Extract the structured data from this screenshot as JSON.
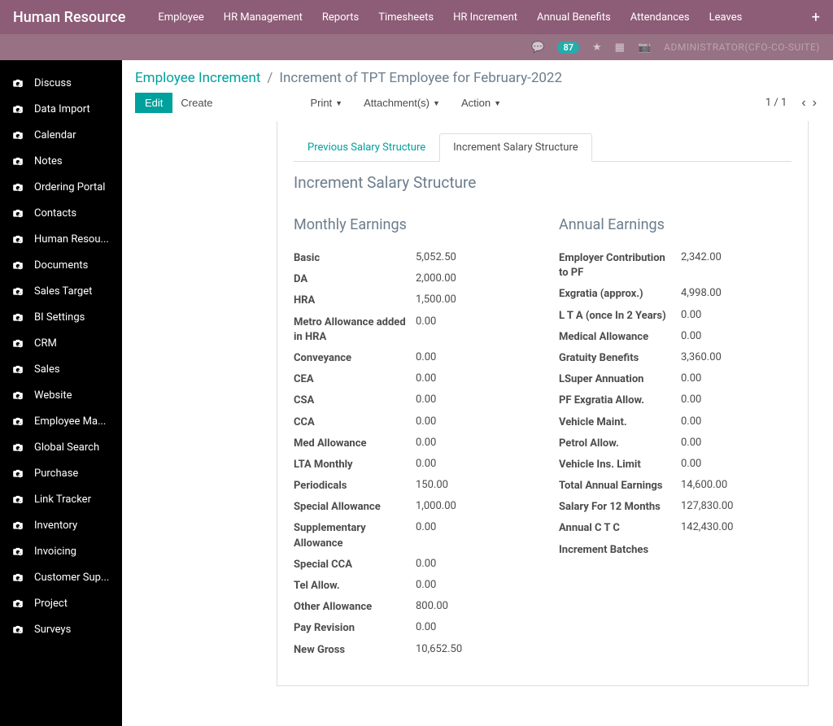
{
  "topbar": {
    "app_title": "Human Resource",
    "menu": [
      "Employee",
      "HR Management",
      "Reports",
      "Timesheets",
      "HR Increment",
      "Annual Benefits",
      "Attendances",
      "Leaves"
    ],
    "badge": "87",
    "admin": "ADMINISTRATOR(CFO-CO-SUITE)"
  },
  "sidebar": {
    "items": [
      {
        "label": "Discuss"
      },
      {
        "label": "Data Import"
      },
      {
        "label": "Calendar"
      },
      {
        "label": "Notes"
      },
      {
        "label": "Ordering Portal"
      },
      {
        "label": "Contacts"
      },
      {
        "label": "Human Resou..."
      },
      {
        "label": "Documents"
      },
      {
        "label": "Sales Target"
      },
      {
        "label": "BI Settings"
      },
      {
        "label": "CRM"
      },
      {
        "label": "Sales"
      },
      {
        "label": "Website"
      },
      {
        "label": "Employee Ma..."
      },
      {
        "label": "Global Search"
      },
      {
        "label": "Purchase"
      },
      {
        "label": "Link Tracker"
      },
      {
        "label": "Inventory"
      },
      {
        "label": "Invoicing"
      },
      {
        "label": "Customer Sup..."
      },
      {
        "label": "Project"
      },
      {
        "label": "Surveys"
      }
    ]
  },
  "breadcrumb": {
    "link": "Employee Increment",
    "current": "Increment of TPT Employee for February-2022"
  },
  "toolbar": {
    "edit": "Edit",
    "create": "Create",
    "print": "Print",
    "attachments": "Attachment(s)",
    "action": "Action"
  },
  "pager": {
    "text": "1 / 1"
  },
  "tabs": {
    "prev": "Previous Salary Structure",
    "curr": "Increment Salary Structure"
  },
  "section_title": "Increment Salary Structure",
  "monthly": {
    "title": "Monthly Earnings",
    "rows": [
      {
        "label": "Basic",
        "value": "5,052.50"
      },
      {
        "label": "DA",
        "value": "2,000.00"
      },
      {
        "label": "HRA",
        "value": "1,500.00"
      },
      {
        "label": "Metro Allowance added in HRA",
        "value": "0.00"
      },
      {
        "label": "Conveyance",
        "value": "0.00"
      },
      {
        "label": "CEA",
        "value": "0.00"
      },
      {
        "label": "CSA",
        "value": "0.00"
      },
      {
        "label": "CCA",
        "value": "0.00"
      },
      {
        "label": "Med Allowance",
        "value": "0.00"
      },
      {
        "label": "LTA Monthly",
        "value": "0.00"
      },
      {
        "label": "Periodicals",
        "value": "150.00"
      },
      {
        "label": "Special Allowance",
        "value": "1,000.00"
      },
      {
        "label": "Supplementary Allowance",
        "value": "0.00"
      },
      {
        "label": "Special CCA",
        "value": "0.00"
      },
      {
        "label": "Tel Allow.",
        "value": "0.00"
      },
      {
        "label": "Other Allowance",
        "value": "800.00"
      },
      {
        "label": "Pay Revision",
        "value": "0.00"
      },
      {
        "label": "New Gross",
        "value": "10,652.50"
      }
    ]
  },
  "annual": {
    "title": "Annual Earnings",
    "rows": [
      {
        "label": "Employer Contribution to PF",
        "value": "2,342.00"
      },
      {
        "label": "Exgratia (approx.)",
        "value": "4,998.00"
      },
      {
        "label": "L T A (once In 2 Years)",
        "value": "0.00"
      },
      {
        "label": "Medical Allowance",
        "value": "0.00"
      },
      {
        "label": "Gratuity Benefits",
        "value": "3,360.00"
      },
      {
        "label": "LSuper Annuation",
        "value": "0.00"
      },
      {
        "label": "PF Exgratia Allow.",
        "value": "0.00"
      },
      {
        "label": "Vehicle Maint.",
        "value": "0.00"
      },
      {
        "label": "Petrol Allow.",
        "value": "0.00"
      },
      {
        "label": "Vehicle Ins. Limit",
        "value": "0.00"
      },
      {
        "label": "Total Annual Earnings",
        "value": "14,600.00"
      },
      {
        "label": "Salary For 12 Months",
        "value": "127,830.00"
      },
      {
        "label": "Annual C T C",
        "value": "142,430.00"
      },
      {
        "label": "Increment Batches",
        "value": ""
      }
    ]
  }
}
